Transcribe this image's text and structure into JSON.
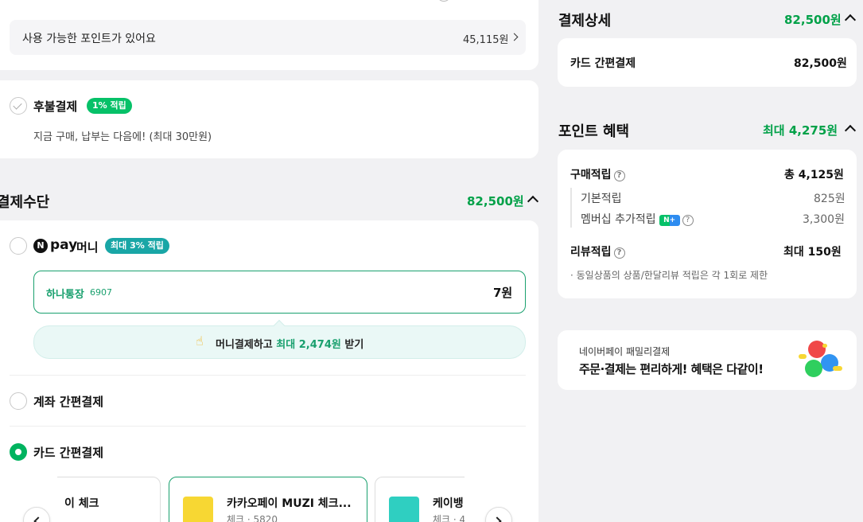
{
  "points_available": {
    "label": "사용 가능한 포인트가 있어요",
    "value": "45,115원"
  },
  "deferred_payment": {
    "title": "후불결제",
    "badge": "1% 적립",
    "desc": "지금 구매, 납부는 다음에! (최대 30만원)"
  },
  "payment_method": {
    "title": "결제수단",
    "amount": "82,500원",
    "npay_money": {
      "brand_pay": "pay",
      "label": "머니",
      "badge": "최대 3% 적립",
      "account_name": "하나통장",
      "account_number": "6907",
      "balance": "7원",
      "promo_prefix": "머니결제하고 ",
      "promo_highlight": "최대 2,474원",
      "promo_suffix": " 받기"
    },
    "account_easy_pay": "계좌 간편결제",
    "card_easy_pay": "카드 간편결제",
    "cards": [
      {
        "name": "이 체크",
        "sub": ""
      },
      {
        "name": "카카오페이 MUZI 체크...",
        "sub": "체크 · 5820"
      },
      {
        "name": "케이뱅",
        "sub": "체크 · 4"
      }
    ]
  },
  "payment_details": {
    "title": "결제상세",
    "amount": "82,500원",
    "row_label": "카드 간편결제",
    "row_value": "82,500원"
  },
  "point_benefits": {
    "title": "포인트 혜택",
    "amount": "최대 4,275원",
    "purchase_label": "구매적립",
    "purchase_value": "총 4,125원",
    "basic_label": "기본적립",
    "basic_value": "825원",
    "member_label": "멤버십 추가적립",
    "member_badge": "N+",
    "member_value": "3,300원",
    "review_label": "리뷰적립",
    "review_value": "최대 150원",
    "note": "· 동일상품의 상품/한달리뷰 적립은 각 1회로 제한"
  },
  "family_banner": {
    "line1": "네이버페이 패밀리결제",
    "line2": "주문·결제는 편리하게! 혜택은 다같이!"
  },
  "colors": {
    "green": "#00a148",
    "teal": "#19a6a6",
    "badge_green": "#06c168",
    "money_border": "#19a06e"
  }
}
